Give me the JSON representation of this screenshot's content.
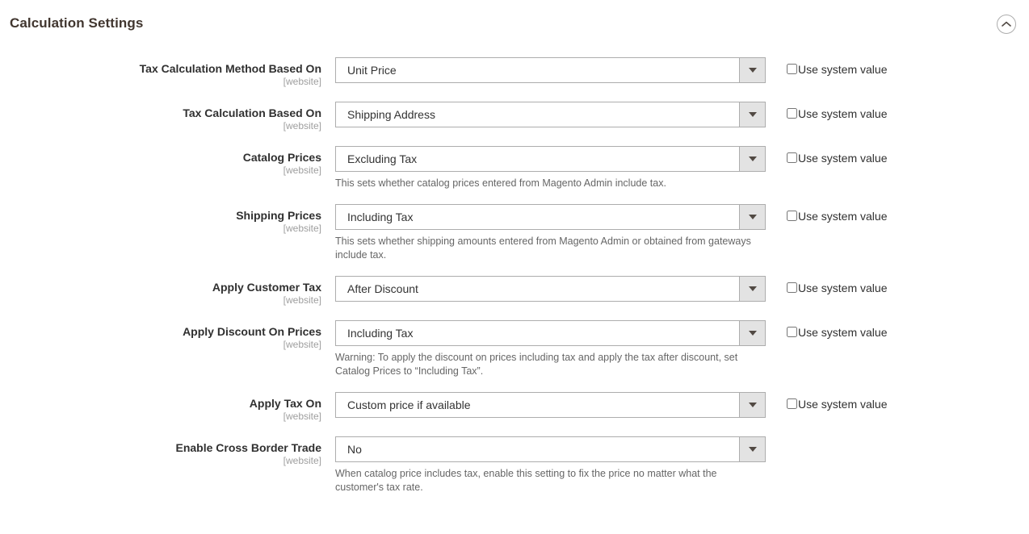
{
  "section": {
    "title": "Calculation Settings",
    "collapse_icon": "chevron-up-circle-icon"
  },
  "common": {
    "scope_website": "[website]",
    "use_system_value": "Use system value",
    "dropdown_icon": "chevron-down-icon"
  },
  "fields": [
    {
      "label": "Tax Calculation Method Based On",
      "scope": "[website]",
      "value": "Unit Price",
      "note": "",
      "has_system_checkbox": true,
      "system_checked": false
    },
    {
      "label": "Tax Calculation Based On",
      "scope": "[website]",
      "value": "Shipping Address",
      "note": "",
      "has_system_checkbox": true,
      "system_checked": false
    },
    {
      "label": "Catalog Prices",
      "scope": "[website]",
      "value": "Excluding Tax",
      "note": "This sets whether catalog prices entered from Magento Admin include tax.",
      "has_system_checkbox": true,
      "system_checked": false
    },
    {
      "label": "Shipping Prices",
      "scope": "[website]",
      "value": "Including Tax",
      "note": "This sets whether shipping amounts entered from Magento Admin or obtained from gateways include tax.",
      "has_system_checkbox": true,
      "system_checked": false
    },
    {
      "label": "Apply Customer Tax",
      "scope": "[website]",
      "value": "After Discount",
      "note": "",
      "has_system_checkbox": true,
      "system_checked": false
    },
    {
      "label": "Apply Discount On Prices",
      "scope": "[website]",
      "value": "Including Tax",
      "note": "Warning: To apply the discount on prices including tax and apply the tax after discount, set Catalog Prices to “Including Tax”.",
      "has_system_checkbox": true,
      "system_checked": false
    },
    {
      "label": "Apply Tax On",
      "scope": "[website]",
      "value": "Custom price if available",
      "note": "",
      "has_system_checkbox": true,
      "system_checked": false
    },
    {
      "label": "Enable Cross Border Trade",
      "scope": "[website]",
      "value": "No",
      "note": "When catalog price includes tax, enable this setting to fix the price no matter what the customer's tax rate.",
      "has_system_checkbox": false,
      "system_checked": false
    }
  ],
  "colors": {
    "title_text": "#41362f",
    "label_text": "#303030",
    "scope_text": "#9e9e9e",
    "note_text": "#666666",
    "border": "#adadad",
    "arrow_button_bg": "#e3e3e3",
    "page_bg": "#ffffff"
  }
}
